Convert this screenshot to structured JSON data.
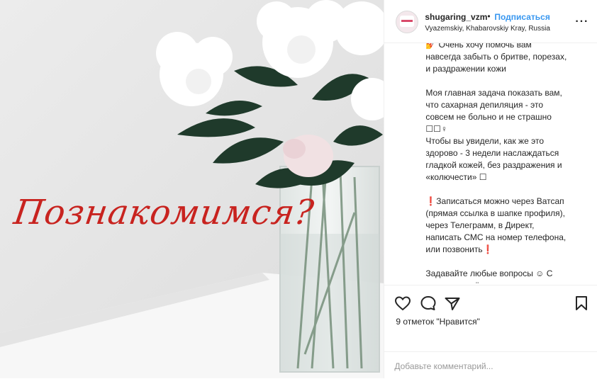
{
  "media": {
    "overlay_text": "Познакомимся?"
  },
  "header": {
    "username": "shugaring_vzm",
    "separator": "•",
    "follow_label": "Подписаться",
    "location": "Vyazemskiy, Khabarovskiy Kray, Russia",
    "more_label": "···"
  },
  "caption": {
    "text": "💅 Очень хочу помочь вам\nнавсегда забыть о бритве, порезах,\nи раздражении кожи\n\nМоя главная задача показать вам,\nчто сахарная депиляция - это\nсовсем не больно и не страшно\n☐☐♀\nЧтобы вы увидели, как же это\nздорово - 3 недели наслаждаться\nгладкой кожей, без раздражения и\n«колючести» ☐\n\n❗Записаться можно через Ватсап\n(прямая ссылка в шапке профиля),\nчерез Телеграмм, в Директ,\nнаписать СМС на номер телефона,\nили позвонить❗\n\nЗадавайте любые вопросы ☺ С\nрадостью всё расскажу,\nпроконсультирую и отвечу на"
  },
  "actions": {
    "like_icon": "heart-icon",
    "comment_icon": "comment-icon",
    "share_icon": "share-icon",
    "save_icon": "bookmark-icon"
  },
  "likes": {
    "text": "9 отметок \"Нравится\""
  },
  "comment": {
    "placeholder": "Добавьте комментарий..."
  }
}
